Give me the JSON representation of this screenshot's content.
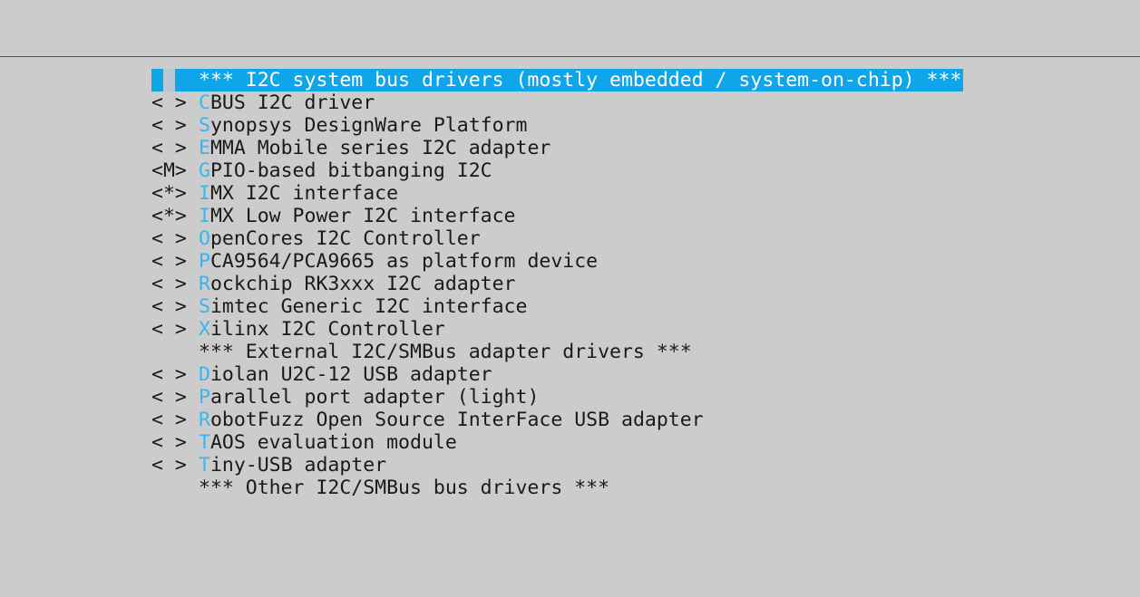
{
  "menu": {
    "items": [
      {
        "mark": "",
        "hot": "",
        "text": "*** I2C system bus drivers (mostly embedded / system-on-chip) ***",
        "selected": true
      },
      {
        "mark": "< >",
        "hot": "C",
        "text": "BUS I2C driver"
      },
      {
        "mark": "< >",
        "hot": "S",
        "text": "ynopsys DesignWare Platform"
      },
      {
        "mark": "< >",
        "hot": "E",
        "text": "MMA Mobile series I2C adapter"
      },
      {
        "mark": "<M>",
        "hot": "G",
        "text": "PIO-based bitbanging I2C"
      },
      {
        "mark": "<*>",
        "hot": "I",
        "text": "MX I2C interface"
      },
      {
        "mark": "<*>",
        "hot": "I",
        "text": "MX Low Power I2C interface"
      },
      {
        "mark": "< >",
        "hot": "O",
        "text": "penCores I2C Controller"
      },
      {
        "mark": "< >",
        "hot": "P",
        "text": "CA9564/PCA9665 as platform device"
      },
      {
        "mark": "< >",
        "hot": "R",
        "text": "ockchip RK3xxx I2C adapter"
      },
      {
        "mark": "< >",
        "hot": "S",
        "text": "imtec Generic I2C interface"
      },
      {
        "mark": "< >",
        "hot": "X",
        "text": "ilinx I2C Controller"
      },
      {
        "mark": "",
        "hot": "",
        "text": "*** External I2C/SMBus adapter drivers ***"
      },
      {
        "mark": "< >",
        "hot": "D",
        "text": "iolan U2C-12 USB adapter"
      },
      {
        "mark": "< >",
        "hot": "P",
        "text": "arallel port adapter (light)"
      },
      {
        "mark": "< >",
        "hot": "R",
        "text": "obotFuzz Open Source InterFace USB adapter"
      },
      {
        "mark": "< >",
        "hot": "T",
        "text": "AOS evaluation module"
      },
      {
        "mark": "< >",
        "hot": "T",
        "text": "iny-USB adapter"
      },
      {
        "mark": "",
        "hot": "",
        "text": "*** Other I2C/SMBus bus drivers ***"
      }
    ]
  }
}
